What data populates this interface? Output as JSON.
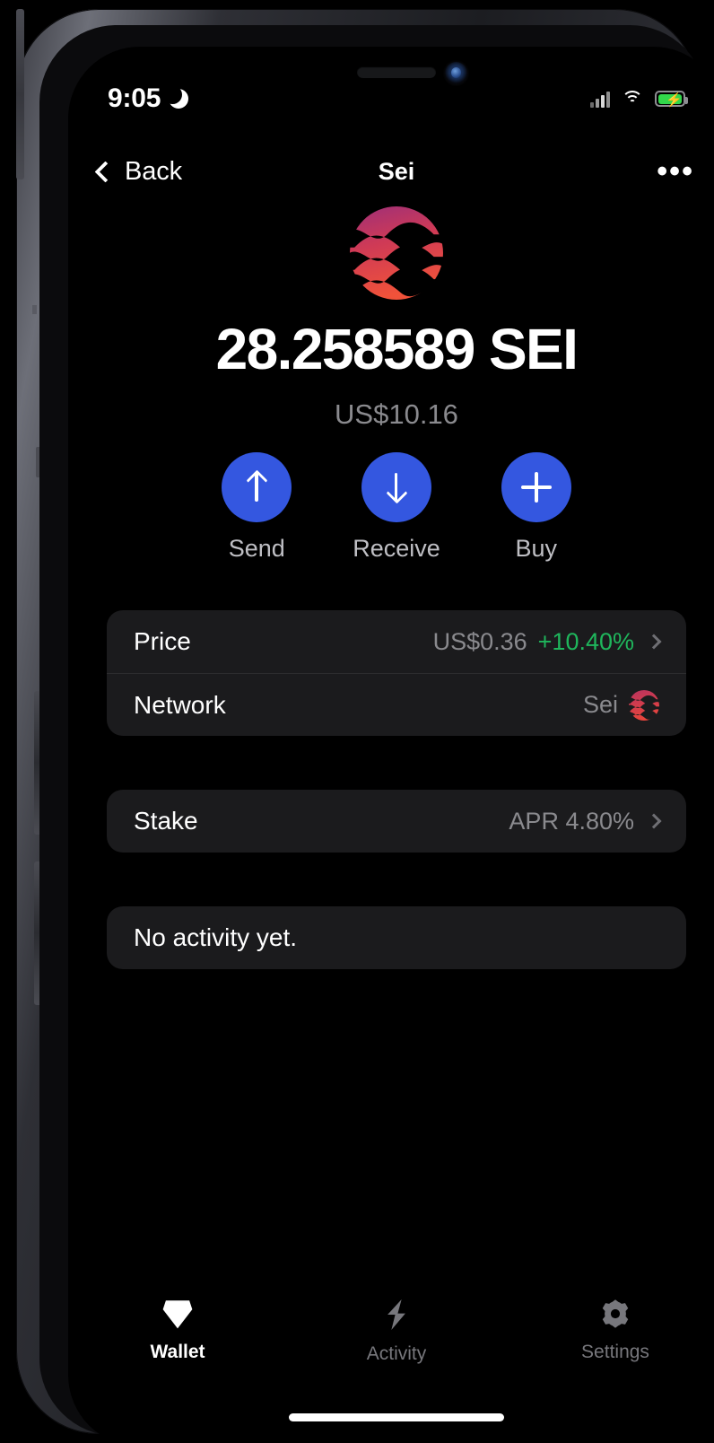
{
  "status_bar": {
    "time": "9:05",
    "dnd_icon": "moon-icon",
    "cellular_icon": "cellular-signal-icon",
    "wifi_icon": "wifi-icon",
    "battery_icon": "battery-charging-icon",
    "battery_color": "#32d74b"
  },
  "nav": {
    "back_label": "Back",
    "title": "Sei",
    "more_label": "•••"
  },
  "token": {
    "logo_icon": "sei-logo-icon",
    "balance": "28.258589 SEI",
    "fiat_value": "US$10.16"
  },
  "actions": [
    {
      "label": "Send",
      "icon": "arrow-up-icon"
    },
    {
      "label": "Receive",
      "icon": "arrow-down-icon"
    },
    {
      "label": "Buy",
      "icon": "plus-icon"
    }
  ],
  "info_rows": {
    "price": {
      "label": "Price",
      "value": "US$0.36",
      "change": "+10.40%",
      "change_color": "#1fb65c"
    },
    "network": {
      "label": "Network",
      "value": "Sei",
      "icon": "sei-logo-icon"
    }
  },
  "stake": {
    "label": "Stake",
    "value": "APR 4.80%"
  },
  "activity": {
    "empty_text": "No activity yet."
  },
  "tabs": [
    {
      "label": "Wallet",
      "icon": "gem-icon",
      "active": true
    },
    {
      "label": "Activity",
      "icon": "bolt-icon",
      "active": false
    },
    {
      "label": "Settings",
      "icon": "gear-icon",
      "active": false
    }
  ],
  "theme": {
    "background": "#000000",
    "card": "#1b1b1d",
    "accent_blue": "#3457e0",
    "muted_text": "#8a8a8e",
    "sei_brand_top": "#b5356b",
    "sei_brand_bottom": "#e8453c"
  }
}
